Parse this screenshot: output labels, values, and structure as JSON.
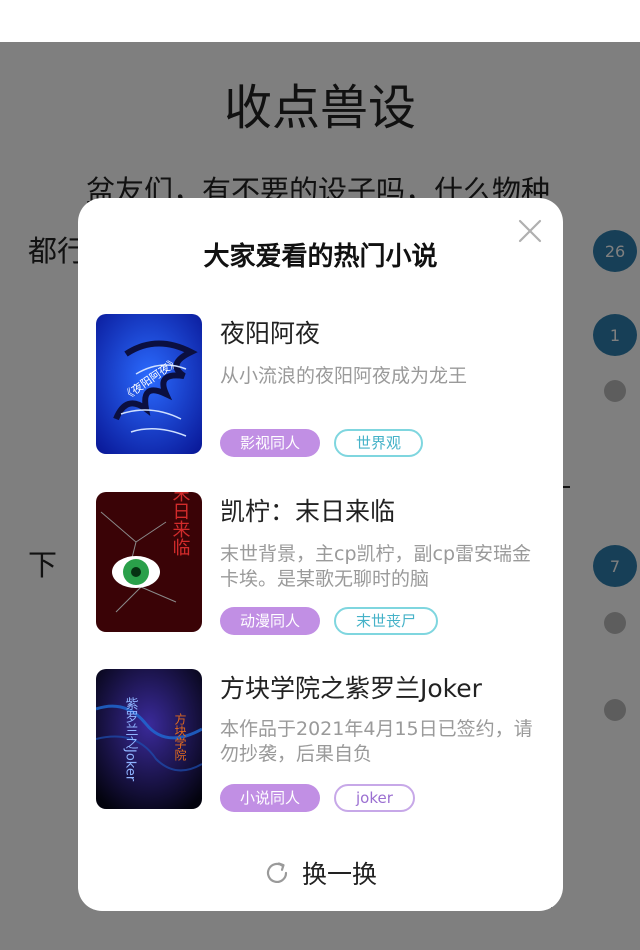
{
  "background": {
    "title": "收点兽设",
    "text_line1": "盆友们，有不要的设子吗，什么物种",
    "text_line2": "都行",
    "text_line3": "下",
    "badges": [
      "26",
      "1",
      "7"
    ]
  },
  "modal": {
    "title": "大家爱看的热门小说",
    "books": [
      {
        "title": "夜阳阿夜",
        "description": "从小流浪的夜阳阿夜成为龙王",
        "cover_text": "《夜阳阿夜》",
        "tags": [
          "影视同人",
          "世界观"
        ]
      },
      {
        "title": "凯柠：末日来临",
        "description": "末世背景，主cp凯柠，副cp雷安瑞金卡埃。是某歌无聊时的脑",
        "cover_text": "末日来临",
        "tags": [
          "动漫同人",
          "末世丧尸"
        ]
      },
      {
        "title": "方块学院之紫罗兰Joker",
        "description": "本作品于2021年4月15日已签约，请勿抄袭，后果自负",
        "cover_text": "紫罗兰之Joker",
        "tags": [
          "小说同人",
          "joker"
        ]
      }
    ],
    "refresh_label": "换一换"
  },
  "colors": {
    "tag_filled": "#c18fe4",
    "tag_teal": "#7fd6df",
    "badge": "#2e7fae",
    "overlay": "rgba(0,0,0,0.5)"
  },
  "icons": {
    "close": "close-icon",
    "refresh": "refresh-icon"
  }
}
